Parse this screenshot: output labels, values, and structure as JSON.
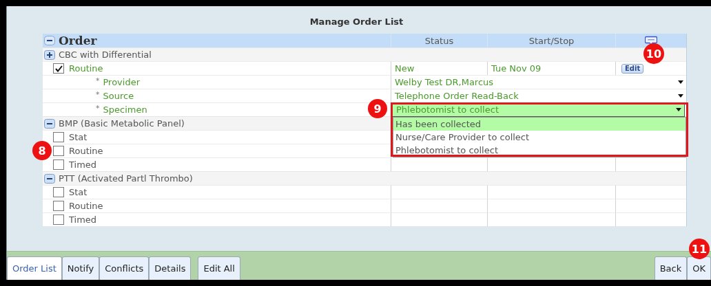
{
  "window": {
    "title": "Manage Order List"
  },
  "table": {
    "columns": [
      {
        "kind": "order",
        "label": "Order"
      },
      {
        "kind": "text",
        "label": "Status"
      },
      {
        "kind": "text",
        "label": "Start/Stop"
      },
      {
        "kind": "comment",
        "callout": "10"
      }
    ],
    "groups": [
      {
        "name": "CBC with Differential",
        "expanded": false,
        "rows": [
          {
            "kind": "option",
            "label": "Routine",
            "checked": true,
            "status": "New",
            "start": "Tue  Nov  09",
            "action": "Edit"
          },
          {
            "kind": "detail",
            "marker": "*",
            "label": "Provider",
            "value": "Welby Test DR,Marcus",
            "open": false
          },
          {
            "kind": "detail",
            "marker": "*",
            "label": "Source",
            "value": "Telephone Order Read-Back",
            "open": false
          },
          {
            "kind": "detail",
            "marker": "*",
            "label": "Specimen",
            "value": "Phlebotomist to collect",
            "callout": "9",
            "open": true,
            "options": [
              {
                "label": "Has been collected",
                "highlighted": true
              },
              {
                "label": "Nurse/Care Provider to collect",
                "highlighted": false
              },
              {
                "label": "Phlebotomist to collect",
                "highlighted": false
              }
            ]
          }
        ]
      },
      {
        "name": "BMP (Basic Metabolic Panel)",
        "expanded": true,
        "rows": [
          {
            "kind": "option",
            "label": "Stat",
            "checked": false
          },
          {
            "kind": "option",
            "label": "Routine",
            "checked": false,
            "callout": "8"
          },
          {
            "kind": "option",
            "label": "Timed",
            "checked": false
          }
        ]
      },
      {
        "name": "PTT (Activated Partl Thrombo)",
        "expanded": true,
        "rows": [
          {
            "kind": "option",
            "label": "Stat",
            "checked": false
          },
          {
            "kind": "option",
            "label": "Routine",
            "checked": false
          },
          {
            "kind": "option",
            "label": "Timed",
            "checked": false
          }
        ]
      }
    ]
  },
  "footer": {
    "tabs": [
      {
        "label": "Order List",
        "selected": true
      },
      {
        "label": "Notify",
        "selected": false
      },
      {
        "label": "Conflicts",
        "selected": false
      },
      {
        "label": "Details",
        "selected": false
      }
    ],
    "left_buttons": [
      {
        "label": "Edit All"
      }
    ],
    "right_buttons": [
      {
        "label": "Back"
      },
      {
        "label": "OK",
        "callout": "11"
      }
    ]
  }
}
